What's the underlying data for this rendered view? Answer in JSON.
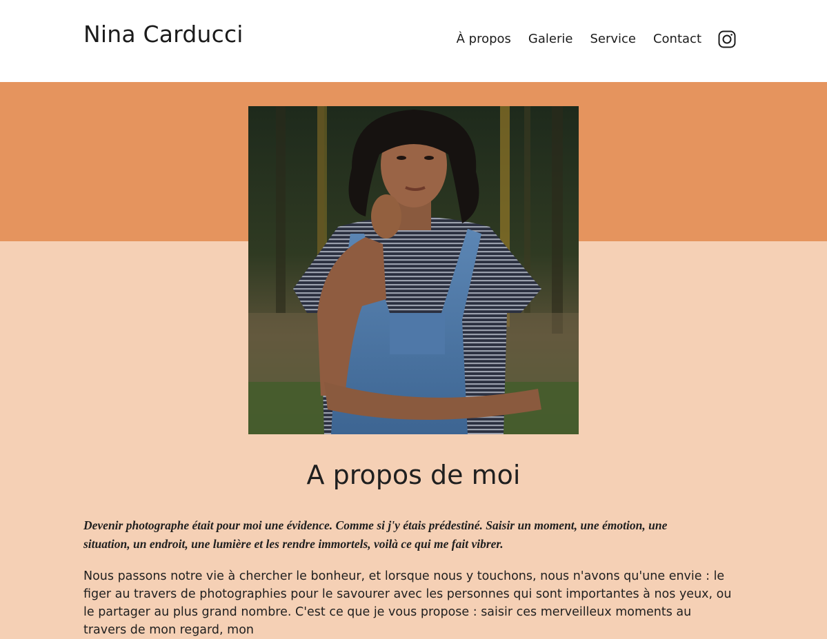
{
  "header": {
    "brand": "Nina Carducci",
    "nav": [
      {
        "label": "À propos"
      },
      {
        "label": "Galerie"
      },
      {
        "label": "Service"
      },
      {
        "label": "Contact"
      }
    ],
    "social_icon": "instagram-icon"
  },
  "colors": {
    "header_bg": "#ffffff",
    "band_top": "#e5945e",
    "band_bottom": "#f5d0b5",
    "text": "#1f1f1f"
  },
  "about": {
    "portrait_alt": "Portrait de Nina Carducci",
    "title": "A propos de moi",
    "lead": "Devenir photographe était pour moi une évidence. Comme si j'y étais prédestiné. Saisir un moment, une émotion, une situation, un endroit, une lumière et les rendre immortels, voilà ce qui me fait vibrer.",
    "body": "Nous passons notre vie à chercher le bonheur, et lorsque nous y touchons, nous n'avons qu'une envie : le figer au travers de photographies pour le savourer avec les personnes qui sont importantes à nos yeux, ou le partager au plus grand nombre. C'est ce que je vous propose : saisir ces merveilleux moments au travers de mon regard, mon"
  }
}
